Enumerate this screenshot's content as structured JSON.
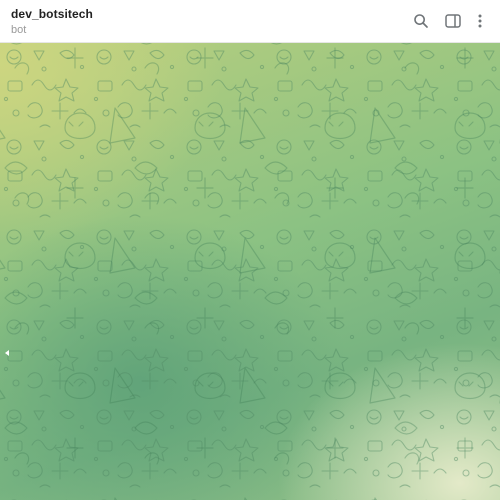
{
  "chat": {
    "title": "dev_botsitech",
    "subtitle": "bot"
  },
  "header": {
    "icons": [
      "search-icon",
      "sidebar-toggle-icon",
      "more-vertical-icon"
    ]
  },
  "colors": {
    "header_bg": "#ffffff",
    "title_text": "#222222",
    "subtitle_text": "#9a9a9a",
    "icon_color": "#707579",
    "wallpaper_yellow": "#c6d47f",
    "wallpaper_green": "#6fae7f",
    "wallpaper_light": "#e6ebcc"
  }
}
